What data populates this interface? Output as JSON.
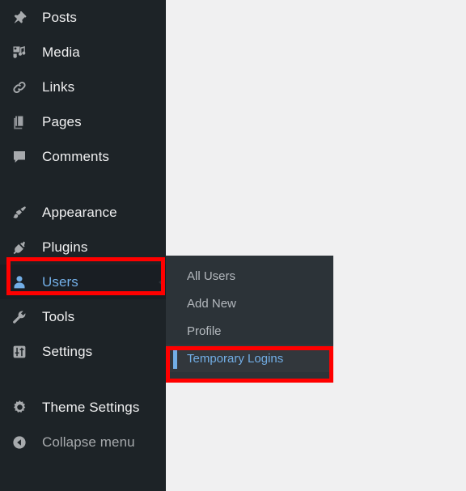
{
  "app": {
    "name": "WordPress Admin Menu",
    "sidebar_bg": "#1d2327",
    "submenu_bg": "#2c3338",
    "content_bg": "#f0f0f1",
    "accent_blue": "#72aee6",
    "annotation_color": "#ff0000"
  },
  "sidebar": {
    "groups": [
      {
        "items": [
          {
            "label": "Posts",
            "icon": "pin-icon",
            "state": "default"
          },
          {
            "label": "Media",
            "icon": "media-icon",
            "state": "default"
          },
          {
            "label": "Links",
            "icon": "link-icon",
            "state": "default"
          },
          {
            "label": "Pages",
            "icon": "pages-icon",
            "state": "default"
          },
          {
            "label": "Comments",
            "icon": "comment-icon",
            "state": "default"
          }
        ]
      },
      {
        "items": [
          {
            "label": "Appearance",
            "icon": "paintbrush-icon",
            "state": "default"
          },
          {
            "label": "Plugins",
            "icon": "plug-icon",
            "state": "default"
          },
          {
            "label": "Users",
            "icon": "user-icon",
            "state": "current"
          },
          {
            "label": "Tools",
            "icon": "wrench-icon",
            "state": "default"
          },
          {
            "label": "Settings",
            "icon": "sliders-icon",
            "state": "default"
          }
        ]
      },
      {
        "items": [
          {
            "label": "Theme Settings",
            "icon": "gear-icon",
            "state": "default"
          },
          {
            "label": "Collapse menu",
            "icon": "collapse-left-icon",
            "state": "dim"
          }
        ]
      }
    ]
  },
  "submenu": {
    "parent": "Users",
    "items": [
      {
        "label": "All Users",
        "state": "default"
      },
      {
        "label": "Add New",
        "state": "default"
      },
      {
        "label": "Profile",
        "state": "default"
      },
      {
        "label": "Temporary Logins",
        "state": "current"
      }
    ]
  },
  "annotations": [
    {
      "name": "users-highlight",
      "target": "Users",
      "color": "#ff0000"
    },
    {
      "name": "temporary-logins-highlight",
      "target": "Temporary Logins",
      "color": "#ff0000"
    }
  ]
}
